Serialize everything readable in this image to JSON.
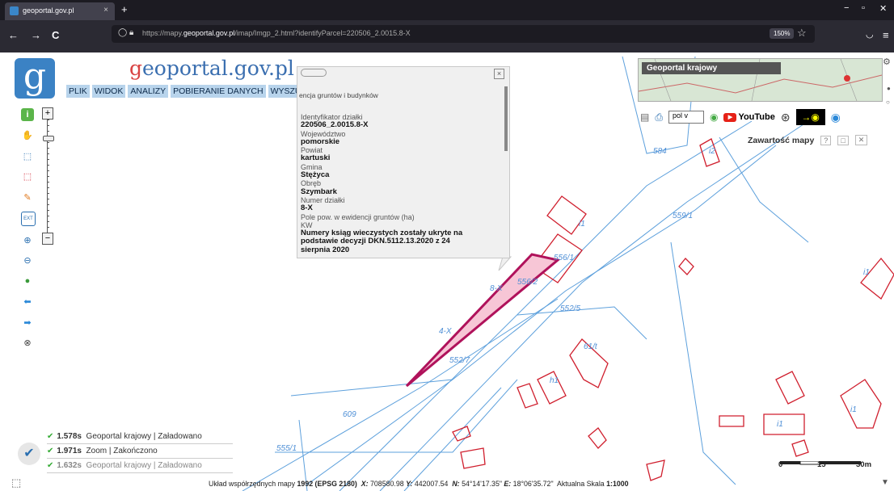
{
  "browser": {
    "tab_title": "geoportal.gov.pl",
    "tab_close": "×",
    "new_tab": "+",
    "url_prefix": "https://mapy.",
    "url_host": "geoportal.gov.pl",
    "url_path": "/imap/Imgp_2.html?identifyParcel=220506_2.0015.8-X",
    "zoom": "150%",
    "back": "←",
    "forward": "→",
    "reload": "C",
    "minimize": "−",
    "restore": "▫",
    "close": "✕"
  },
  "app": {
    "logo_glyph": "g",
    "site_name_g": "g",
    "site_name_rest": "eoportal.gov.pl",
    "menu": [
      "PLIK",
      "WIDOK",
      "ANALIZY",
      "POBIERANIE DANYCH",
      "WYSZUKIWANIA"
    ],
    "zoom_in": "+",
    "zoom_out": "−"
  },
  "popup": {
    "header": "encja gruntów i budynków",
    "close": "×",
    "fields": [
      {
        "label": "Identyfikator działki",
        "value": "220506_2.0015.8-X"
      },
      {
        "label": "Województwo",
        "value": "pomorskie"
      },
      {
        "label": "Powiat",
        "value": "kartuski"
      },
      {
        "label": "Gmina",
        "value": "Stężyca"
      },
      {
        "label": "Obręb",
        "value": "Szymbark"
      },
      {
        "label": "Numer działki",
        "value": "8-X"
      },
      {
        "label": "Pole pow. w ewidencji gruntów (ha)",
        "value": ""
      },
      {
        "label": "KW",
        "value": "Numery ksiąg wieczystych zostały ukryte na podstawie decyzji DKN.5112.13.2020 z 24 sierpnia 2020"
      }
    ]
  },
  "minimap": {
    "title": "Geoportal krajowy"
  },
  "iconbar": {
    "lang": "pol",
    "lang_arrow": "v",
    "youtube": "YouTube"
  },
  "legend": {
    "title": "Zawartość mapy",
    "help": "?",
    "min": "□",
    "close": "✕"
  },
  "map_labels": {
    "parcels": [
      "584",
      "i2",
      "559/1",
      "i1",
      "8-X",
      "556/2",
      "556/1",
      "552/5",
      "4-X",
      "552/7",
      "61/t",
      "609",
      "555/1",
      "i1",
      "i1",
      "i1",
      "h1"
    ],
    "colors": {
      "parcel_line": "#5da0dc",
      "building": "#d01f2e",
      "highlight_fill": "#f7c6d6",
      "highlight_stroke": "#b0125b"
    }
  },
  "status": [
    {
      "time": "1.578s",
      "layer": "Geoportal krajowy",
      "state": "Załadowano"
    },
    {
      "time": "1.971s",
      "layer": "Zoom",
      "state": "Zakończono"
    },
    {
      "time": "1.632s",
      "layer": "Geoportal krajowy",
      "state": "Załadowano"
    }
  ],
  "footer": {
    "crs_label": "Układ współrzędnych mapy",
    "crs_value": "1992 (EPSG 2180)",
    "x_label": "X:",
    "x_value": "708580.98",
    "y_label": "Y:",
    "y_value": "442007.54",
    "n_label": "N:",
    "n_value": "54°14'17.35\"",
    "e_label": "E:",
    "e_value": "18°06'35.72\"",
    "scale_label": "Aktualna Skala",
    "scale_value": "1:1000"
  },
  "scale": {
    "zero": "0",
    "mid": "15",
    "end": "30m"
  }
}
